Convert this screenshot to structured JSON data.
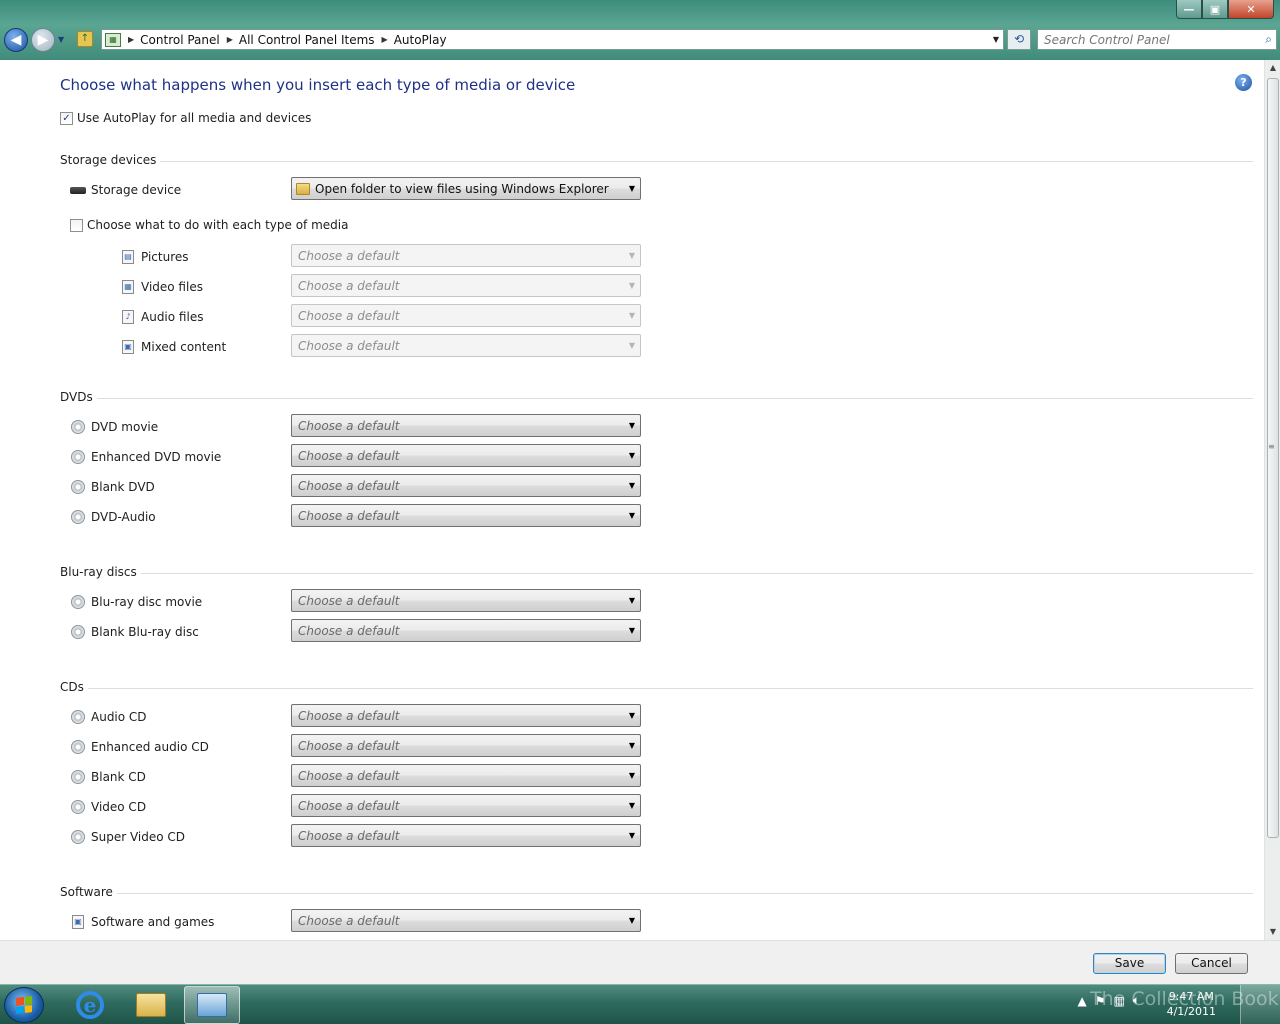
{
  "window": {
    "minimize": "—",
    "maximize": "▣",
    "close": "✕"
  },
  "address": {
    "crumbs": [
      "Control Panel",
      "All Control Panel Items",
      "AutoPlay"
    ]
  },
  "search": {
    "placeholder": "Search Control Panel"
  },
  "page": {
    "title": "Choose what happens when you insert each type of media or device",
    "use_autoplay_label": "Use AutoPlay for all media and devices",
    "use_autoplay_checked": true,
    "help": "?"
  },
  "sections": {
    "storage": {
      "label": "Storage devices",
      "storage_device": {
        "label": "Storage device",
        "value": "Open folder to view files using Windows Explorer"
      },
      "each_media_label": "Choose what to do with each type of media",
      "each_media_checked": false,
      "media": [
        {
          "label": "Pictures",
          "value": "Choose a default",
          "icon": "pictures-icon"
        },
        {
          "label": "Video files",
          "value": "Choose a default",
          "icon": "video-files-icon"
        },
        {
          "label": "Audio files",
          "value": "Choose a default",
          "icon": "audio-files-icon"
        },
        {
          "label": "Mixed content",
          "value": "Choose a default",
          "icon": "mixed-content-icon"
        }
      ]
    },
    "dvds": {
      "label": "DVDs",
      "items": [
        {
          "label": "DVD movie",
          "value": "Choose a default"
        },
        {
          "label": "Enhanced DVD movie",
          "value": "Choose a default"
        },
        {
          "label": "Blank DVD",
          "value": "Choose a default"
        },
        {
          "label": "DVD-Audio",
          "value": "Choose a default"
        }
      ]
    },
    "bluray": {
      "label": "Blu-ray discs",
      "items": [
        {
          "label": "Blu-ray disc movie",
          "value": "Choose a default"
        },
        {
          "label": "Blank Blu-ray disc",
          "value": "Choose a default"
        }
      ]
    },
    "cds": {
      "label": "CDs",
      "items": [
        {
          "label": "Audio CD",
          "value": "Choose a default"
        },
        {
          "label": "Enhanced audio CD",
          "value": "Choose a default"
        },
        {
          "label": "Blank CD",
          "value": "Choose a default"
        },
        {
          "label": "Video CD",
          "value": "Choose a default"
        },
        {
          "label": "Super Video CD",
          "value": "Choose a default"
        }
      ]
    },
    "software": {
      "label": "Software",
      "items": [
        {
          "label": "Software and games",
          "value": "Choose a default"
        }
      ]
    }
  },
  "footer": {
    "save": "Save",
    "cancel": "Cancel"
  },
  "taskbar": {
    "clock_time": "9:47 AM",
    "clock_date": "4/1/2011",
    "watermark": "The Collection Book"
  },
  "colors": {
    "title": "#1e3287",
    "accent": "#3c7fb1",
    "taskbar": "#2f6a5e"
  }
}
